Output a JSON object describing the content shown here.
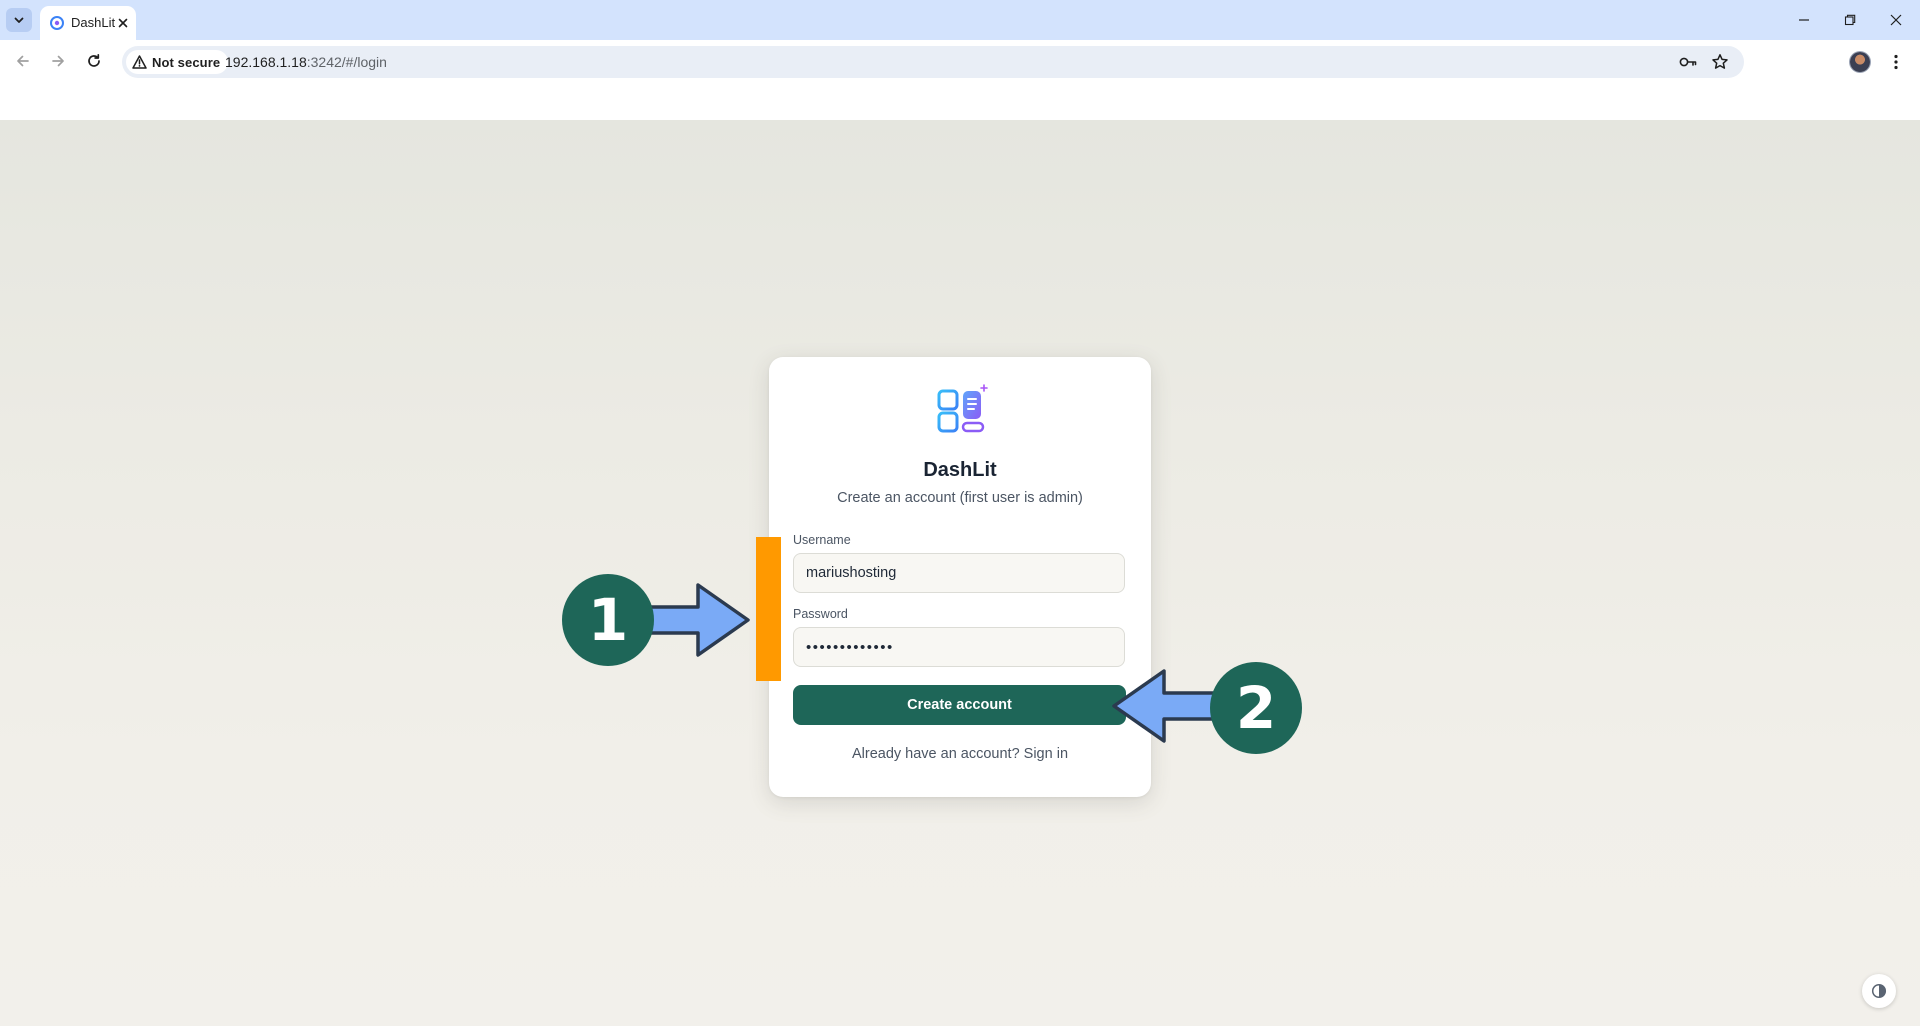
{
  "browser": {
    "tab_title": "DashLit",
    "security_label": "Not secure",
    "url_host": "192.168.1.18",
    "url_rest": ":3242/#/login"
  },
  "login": {
    "app_name": "DashLit",
    "subtitle": "Create an account (first user is admin)",
    "username_label": "Username",
    "username_value": "mariushosting",
    "password_label": "Password",
    "password_value": "mariushosting",
    "submit_label": "Create account",
    "switch_text": "Already have an account? Sign in"
  },
  "annotations": {
    "step1": "1",
    "step2": "2"
  },
  "colors": {
    "brand": "#1e6658",
    "marker": "#ff9900",
    "arrow": "#7aaaf6"
  }
}
